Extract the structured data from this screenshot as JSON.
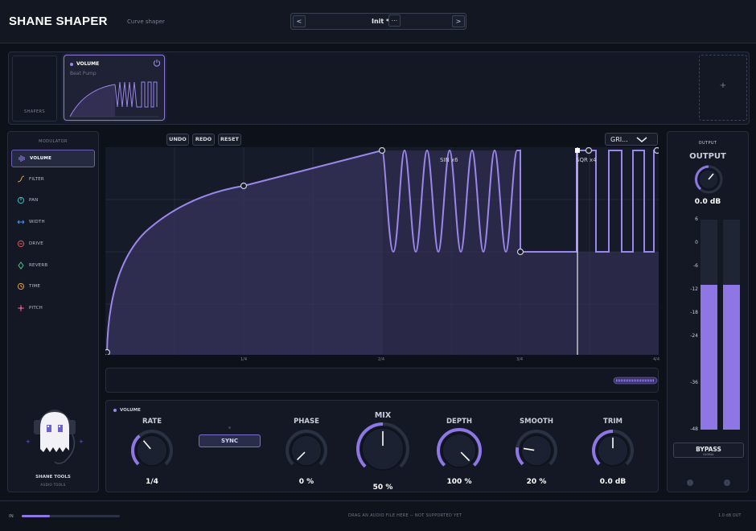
{
  "header": {
    "title": "SHANE SHAPER",
    "subtitle": "Curve shaper",
    "preset_prev": "<",
    "preset_name": "Init *",
    "preset_menu": "...",
    "preset_next": ">"
  },
  "shapers": {
    "empty_label": "SHAPERS",
    "card_name": "VOLUME",
    "card_preset": "Beat Pump",
    "add_label": "+"
  },
  "modulator": {
    "title": "MODULATOR",
    "items": [
      {
        "label": "VOLUME",
        "icon": "volume-icon",
        "color": "#9a86ec"
      },
      {
        "label": "FILTER",
        "icon": "filter-icon",
        "color": "#e0a040"
      },
      {
        "label": "PAN",
        "icon": "pan-icon",
        "color": "#35c2c2"
      },
      {
        "label": "WIDTH",
        "icon": "width-icon",
        "color": "#4a8ff0"
      },
      {
        "label": "DRIVE",
        "icon": "drive-icon",
        "color": "#e25757"
      },
      {
        "label": "REVERB",
        "icon": "reverb-icon",
        "color": "#46c38a"
      },
      {
        "label": "TIME",
        "icon": "time-icon",
        "color": "#e0a040"
      },
      {
        "label": "PITCH",
        "icon": "pitch-icon",
        "color": "#e25b87"
      }
    ],
    "brand_name": "SHANE TOOLS",
    "brand_sub": "AUDIO TOOLS"
  },
  "editor": {
    "undo": "UNDO",
    "redo": "REDO",
    "reset": "RESET",
    "grid_select": "GRI...",
    "segments": [
      "SIN x6",
      "SQR x4"
    ],
    "x_ticks": [
      "1/4",
      "2/4",
      "3/4",
      "4/4"
    ],
    "accent": "#8e77e4"
  },
  "knobs": {
    "title": "VOLUME",
    "sync_label": "SYNC",
    "items": [
      {
        "label": "RATE",
        "value": "1/4",
        "level": 0.35
      },
      {
        "label": "PHASE",
        "value": "0 %",
        "level": 0.0
      },
      {
        "label": "MIX",
        "value": "50 %",
        "level": 0.5
      },
      {
        "label": "DEPTH",
        "value": "100 %",
        "level": 1.0
      },
      {
        "label": "SMOOTH",
        "value": "20 %",
        "level": 0.2
      },
      {
        "label": "TRIM",
        "value": "0.0 dB",
        "level": 0.5
      }
    ]
  },
  "output": {
    "header": "OUTPUT",
    "title": "OUTPUT",
    "value": "0.0 dB",
    "scale": [
      "6",
      "0",
      "-6",
      "-12",
      "-18",
      "-24",
      "-36",
      "-48"
    ],
    "meter_left": 0.69,
    "meter_right": 0.69,
    "bypass": "BYPASS",
    "bypass_sub": "GLOBAL"
  },
  "footer": {
    "in_label": "IN",
    "in_level": 0.29,
    "drop_message": "DRAG AN AUDIO FILE HERE -- NOT SUPPORTED YET",
    "right_text": "1.0 dB OUT"
  }
}
